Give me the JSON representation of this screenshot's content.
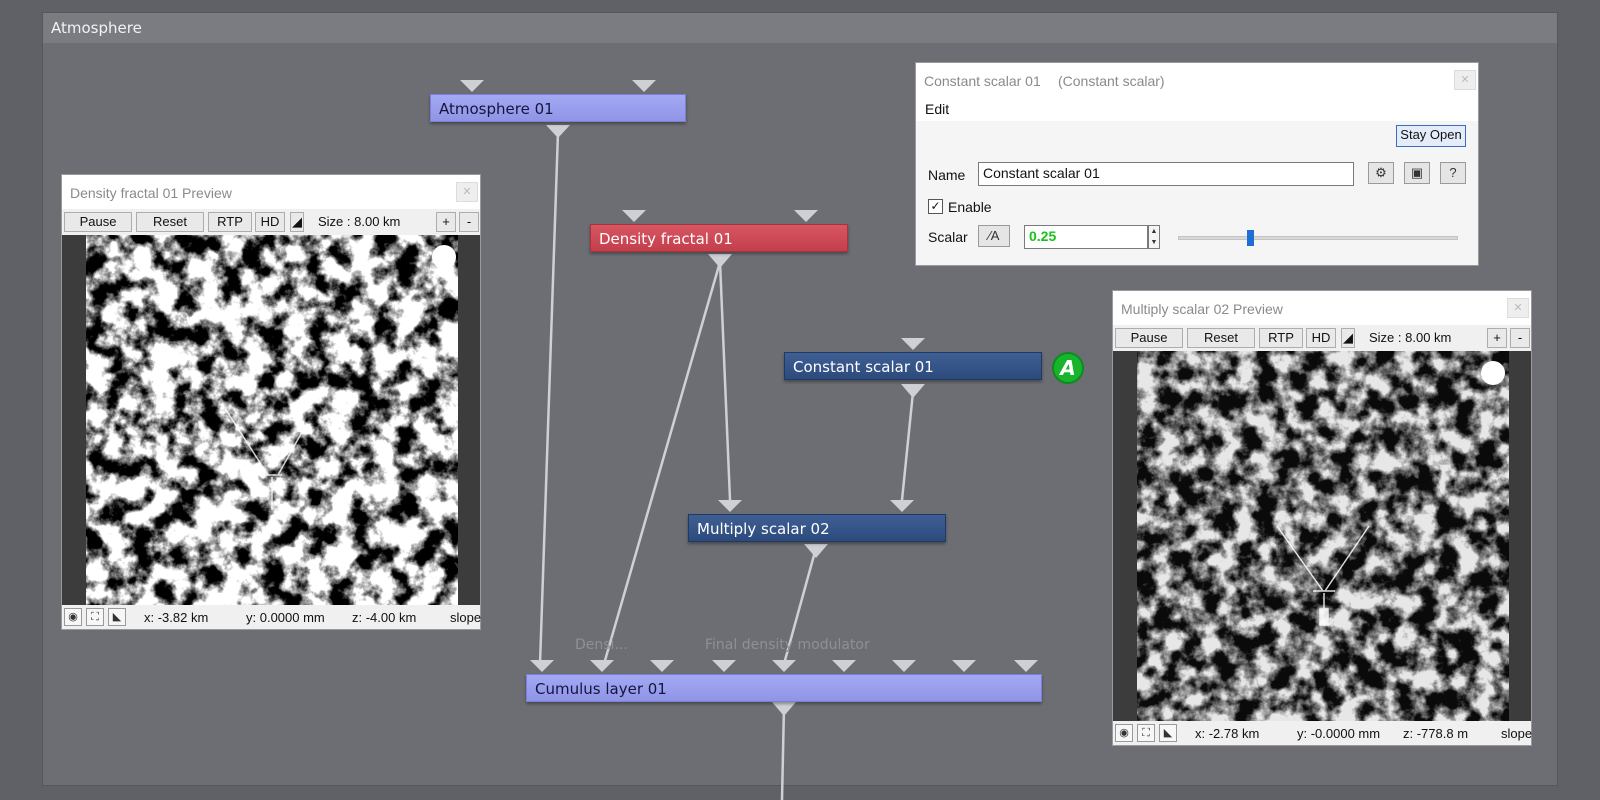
{
  "workspace": {
    "title": "Atmosphere"
  },
  "nodes": {
    "atmosphere": "Atmosphere 01",
    "density_fractal": "Density fractal 01",
    "constant_scalar": "Constant scalar 01",
    "multiply_scalar": "Multiply scalar 02",
    "cumulus_layer": "Cumulus layer 01"
  },
  "input_labels": {
    "density": "Densi...",
    "final_density": "Final density modulator"
  },
  "badge": {
    "letter": "A",
    "color": "#18b52c"
  },
  "preview_left": {
    "title": "Density fractal 01 Preview",
    "pause": "Pause",
    "reset": "Reset",
    "rtp": "RTP",
    "hd": "HD",
    "size": "Size : 8.00 km",
    "plus": "+",
    "minus": "-",
    "x": "x: -3.82 km",
    "y": "y: 0.0000 mm",
    "z": "z: -4.00 km",
    "slope": "slope"
  },
  "preview_right": {
    "title": "Multiply scalar 02 Preview",
    "pause": "Pause",
    "reset": "Reset",
    "rtp": "RTP",
    "hd": "HD",
    "size": "Size : 8.00 km",
    "plus": "+",
    "minus": "-",
    "x": "x: -2.78 km",
    "y": "y: -0.0000 mm",
    "z": "z: -778.8 m",
    "slope": "slope"
  },
  "dialog": {
    "title": "Constant scalar 01",
    "subtitle": "(Constant scalar)",
    "menu_edit": "Edit",
    "stay_open": "Stay Open",
    "name_label": "Name",
    "name_value": "Constant scalar 01",
    "enable_label": "Enable",
    "enable_checked": true,
    "scalar_label": "Scalar",
    "scalar_value": "0.25",
    "scalar_fraction": 0.25,
    "help": "?",
    "value_color": "#19c219"
  }
}
